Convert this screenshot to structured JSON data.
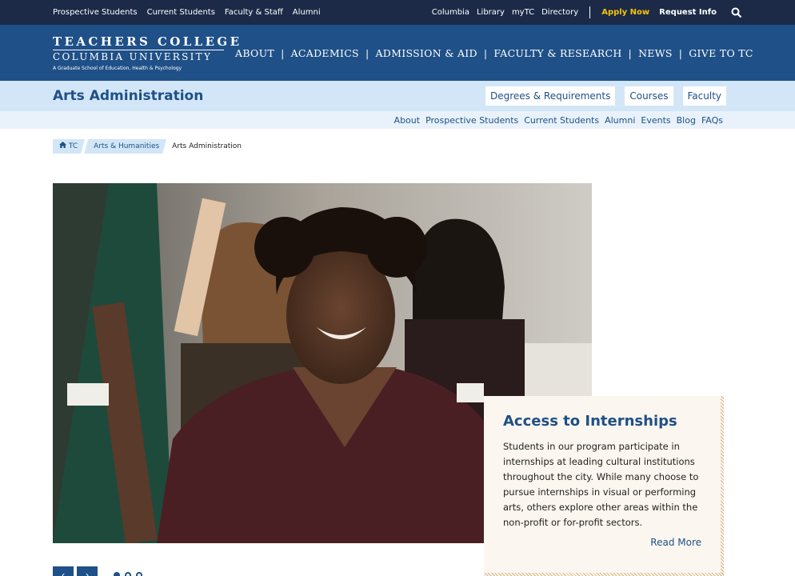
{
  "utility_bar": {
    "left_links": [
      "Prospective Students",
      "Current Students",
      "Faculty & Staff",
      "Alumni"
    ],
    "right_links": [
      "Columbia",
      "Library",
      "myTC",
      "Directory"
    ],
    "apply_label": "Apply Now",
    "request_label": "Request Info",
    "search_icon": "search-icon",
    "apply_color": "#f5c400"
  },
  "masthead": {
    "logo_line1": "TEACHERS COLLEGE",
    "logo_line2": "COLUMBIA UNIVERSITY",
    "logo_line3": "A Graduate School of Education, Health & Psychology",
    "nav": [
      "ABOUT",
      "ACADEMICS",
      "ADMISSION & AID",
      "FACULTY & RESEARCH",
      "NEWS",
      "GIVE TO TC"
    ],
    "nav_divider": "|",
    "brand_color": "#1f5087"
  },
  "program_bar": {
    "title": "Arts Administration",
    "buttons": [
      "Degrees & Requirements",
      "Courses",
      "Faculty"
    ]
  },
  "program_nav": [
    "About",
    "Prospective Students",
    "Current Students",
    "Alumni",
    "Events",
    "Blog",
    "FAQs"
  ],
  "breadcrumb": {
    "home_icon": "home-icon",
    "home": "TC",
    "parent": "Arts & Humanities",
    "current": "Arts Administration"
  },
  "hero": {
    "image_icon": "photo-students-raising-hands"
  },
  "feature_card": {
    "title": "Access to Internships",
    "body": "Students in our program participate in internships at leading cultural institutions throughout the city. While many choose to pursue internships in visual or performing arts, others explore other areas within the non-profit or for-profit sectors.",
    "link": "Read More"
  },
  "slider": {
    "prev_icon": "chevron-left-icon",
    "next_icon": "chevron-right-icon",
    "prev_glyph": "‹",
    "next_glyph": "›",
    "active_slide": 1,
    "slide_count": 3
  }
}
